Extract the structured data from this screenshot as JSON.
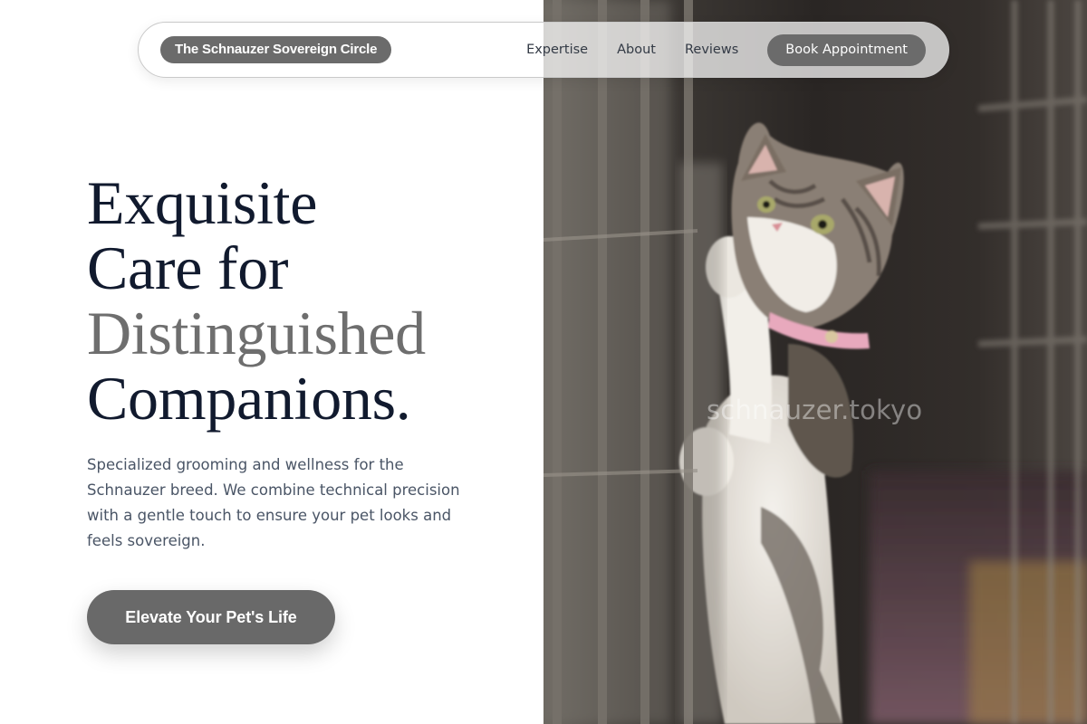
{
  "nav": {
    "brand": "The Schnauzer Sovereign Circle",
    "links": [
      "Expertise",
      "About",
      "Reviews"
    ],
    "cta": "Book Appointment"
  },
  "hero": {
    "headline_lines": [
      "Exquisite",
      "Care for",
      "Distinguished",
      "Companions."
    ],
    "description": "Specialized grooming and wellness for the Schnauzer breed. We combine technical precision with a gentle touch to ensure your pet looks and feels sovereign.",
    "cta": "Elevate Your Pet's Life"
  },
  "image": {
    "subject": "kitten-reaching-through-cage-photo",
    "watermark": "schnauzer.tokyo"
  },
  "colors": {
    "headline": "#111a2e",
    "headline_muted": "#6e6e6e",
    "button_bg": "#6b6b6b",
    "body_text": "#4a5566"
  }
}
